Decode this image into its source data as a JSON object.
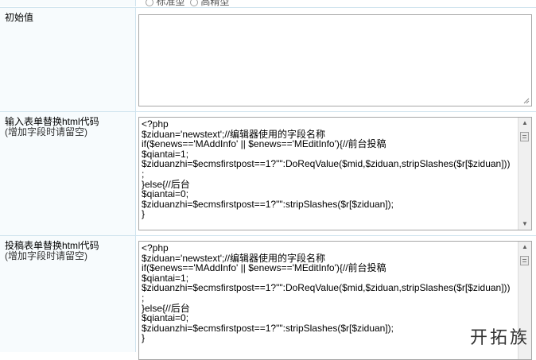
{
  "top_row": {
    "options": [
      "标准型",
      "高精型"
    ]
  },
  "fields": [
    {
      "label": "初始值",
      "hint": "",
      "value": ""
    },
    {
      "label": "输入表单替换html代码",
      "hint": "(增加字段时请留空)",
      "value": "<?php\n$ziduan='newstext';//编辑器使用的字段名称\nif($enews=='MAddInfo' || $enews=='MEditInfo'){//前台投稿\n$qiantai=1;\n$ziduanzhi=$ecmsfirstpost==1?\"\":DoReqValue($mid,$ziduan,stripSlashes($r[$ziduan]))\n;\n}else{//后台\n$qiantai=0;\n$ziduanzhi=$ecmsfirstpost==1?\"\":stripSlashes($r[$ziduan]);\n}"
    },
    {
      "label": "投稿表单替换html代码",
      "hint": "(增加字段时请留空)",
      "value": "<?php\n$ziduan='newstext';//编辑器使用的字段名称\nif($enews=='MAddInfo' || $enews=='MEditInfo'){//前台投稿\n$qiantai=1;\n$ziduanzhi=$ecmsfirstpost==1?\"\":DoReqValue($mid,$ziduan,stripSlashes($r[$ziduan]))\n;\n}else{//后台\n$qiantai=0;\n$ziduanzhi=$ecmsfirstpost==1?\"\":stripSlashes($r[$ziduan]);\n}"
    }
  ],
  "watermark": "开拓族",
  "colors": {
    "border": "#cfe3ee",
    "label_bg": "#f7fbfd",
    "textarea_border": "#a6a6a6"
  }
}
